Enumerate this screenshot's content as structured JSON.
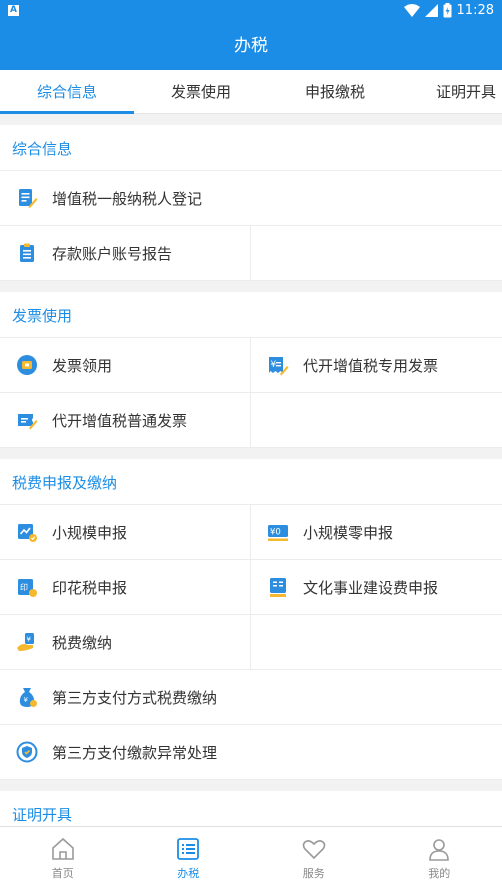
{
  "statusbar": {
    "notif": "A",
    "time": "11:28"
  },
  "header": {
    "title": "办税"
  },
  "tabs": [
    "综合信息",
    "发票使用",
    "申报缴税",
    "证明开具"
  ],
  "sections": {
    "general": {
      "title": "综合信息",
      "items": [
        "增值税一般纳税人登记",
        "存款账户账号报告"
      ]
    },
    "invoice": {
      "title": "发票使用",
      "items": [
        "发票领用",
        "代开增值税专用发票",
        "代开增值税普通发票"
      ]
    },
    "declare": {
      "title": "税费申报及缴纳",
      "items": [
        "小规模申报",
        "小规模零申报",
        "印花税申报",
        "文化事业建设费申报",
        "税费缴纳",
        "第三方支付方式税费缴纳",
        "第三方支付缴款异常处理"
      ]
    },
    "certificate": {
      "title": "证明开具"
    }
  },
  "bottom_nav": [
    "首页",
    "办税",
    "服务",
    "我的"
  ],
  "colors": {
    "primary": "#1c8de6",
    "icon_yellow": "#f5b82e"
  }
}
